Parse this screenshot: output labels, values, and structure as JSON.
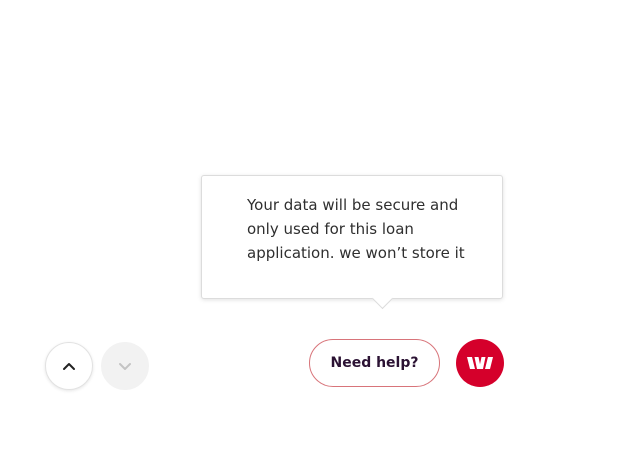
{
  "tooltip": {
    "lines": [
      "Your data will be secure and",
      "only used for this loan",
      "application. we won’t store it"
    ]
  },
  "navigation": {
    "up_icon": "chevron-up-icon",
    "down_icon": "chevron-down-icon",
    "down_enabled": false
  },
  "help": {
    "label": "Need help?"
  },
  "brand": {
    "icon": "westpac-logo-icon",
    "color": "#d5002b"
  },
  "colors": {
    "accent": "#d5002b",
    "help_border": "#d8747a",
    "help_text": "#2b1233"
  }
}
